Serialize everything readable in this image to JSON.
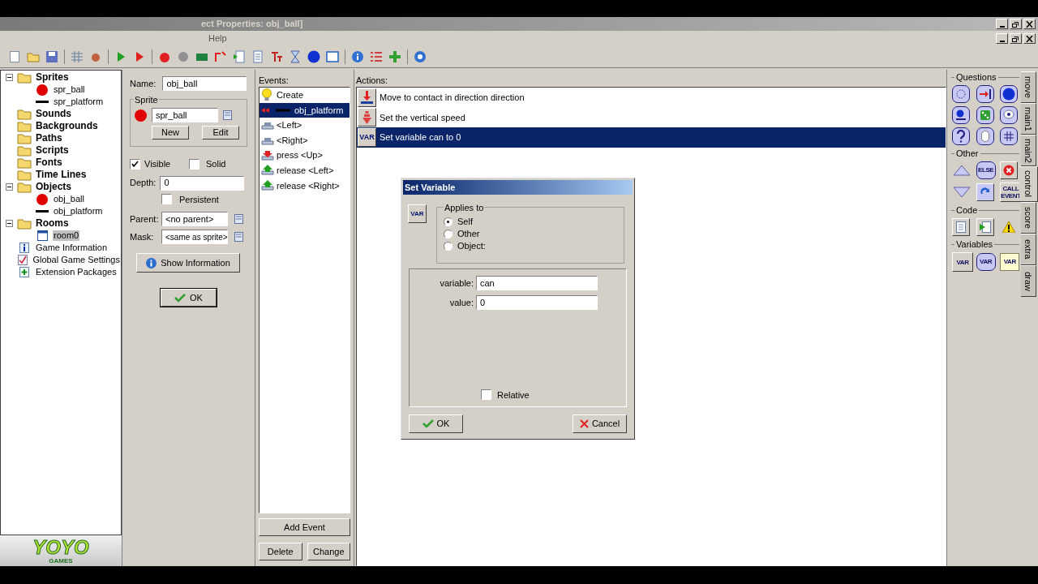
{
  "window": {
    "title": "ect Properties: obj_ball]"
  },
  "menu": [
    "Help"
  ],
  "tree": [
    {
      "label": "Sprites",
      "kind": "folder",
      "expanded": true,
      "selected": false,
      "children": [
        {
          "label": "spr_ball",
          "kind": "ball",
          "selected": false
        },
        {
          "label": "spr_platform",
          "kind": "bar",
          "selected": false
        }
      ]
    },
    {
      "label": "Sounds",
      "kind": "folder",
      "expanded": false,
      "selected": false
    },
    {
      "label": "Backgrounds",
      "kind": "folder",
      "expanded": false,
      "selected": false
    },
    {
      "label": "Paths",
      "kind": "folder",
      "expanded": false,
      "selected": false
    },
    {
      "label": "Scripts",
      "kind": "folder",
      "expanded": false,
      "selected": false
    },
    {
      "label": "Fonts",
      "kind": "folder",
      "expanded": false,
      "selected": false
    },
    {
      "label": "Time Lines",
      "kind": "folder",
      "expanded": false,
      "selected": false
    },
    {
      "label": "Objects",
      "kind": "folder",
      "expanded": true,
      "selected": false,
      "children": [
        {
          "label": "obj_ball",
          "kind": "ball",
          "selected": false
        },
        {
          "label": "obj_platform",
          "kind": "bar",
          "selected": false
        }
      ]
    },
    {
      "label": "Rooms",
      "kind": "folder",
      "expanded": true,
      "selected": false,
      "children": [
        {
          "label": "room0",
          "kind": "room",
          "selected": true
        }
      ]
    },
    {
      "label": "Game Information",
      "kind": "info",
      "selected": false
    },
    {
      "label": "Global Game Settings",
      "kind": "settings",
      "selected": false
    },
    {
      "label": "Extension Packages",
      "kind": "extension",
      "selected": false
    }
  ],
  "logo": {
    "name": "YOYO",
    "sub": "GAMES"
  },
  "properties": {
    "name_label": "Name:",
    "name": "obj_ball",
    "sprite_group": "Sprite",
    "sprite": "spr_ball",
    "new": "New",
    "edit": "Edit",
    "visible": {
      "label": "Visible",
      "checked": true
    },
    "solid": {
      "label": "Solid",
      "checked": false
    },
    "depth_label": "Depth:",
    "depth": "0",
    "persistent": {
      "label": "Persistent",
      "checked": false
    },
    "parent_label": "Parent:",
    "parent": "<no parent>",
    "mask_label": "Mask:",
    "mask": "<same as sprite>",
    "show_info": "Show Information",
    "ok": "OK"
  },
  "events": {
    "label": "Events:",
    "items": [
      {
        "label": "Create",
        "kind": "create",
        "selected": false
      },
      {
        "label": "obj_platform",
        "kind": "collision",
        "selected": true
      },
      {
        "label": "<Left>",
        "kind": "keyboard",
        "selected": false
      },
      {
        "label": "<Right>",
        "kind": "keyboard",
        "selected": false
      },
      {
        "label": "press <Up>",
        "kind": "press",
        "selected": false
      },
      {
        "label": "release <Left>",
        "kind": "release",
        "selected": false
      },
      {
        "label": "release <Right>",
        "kind": "release",
        "selected": false
      }
    ],
    "add": "Add Event",
    "delete": "Delete",
    "change": "Change"
  },
  "actions": {
    "label": "Actions:",
    "items": [
      {
        "label": "Move to contact in direction direction",
        "kind": "contact",
        "selected": false
      },
      {
        "label": "Set the vertical speed",
        "kind": "vspeed",
        "selected": false
      },
      {
        "label": "Set variable can to 0",
        "kind": "var",
        "icon_text": "VAR",
        "selected": true
      }
    ]
  },
  "dialog": {
    "title": "Set Variable",
    "icon_text": "VAR",
    "applies_label": "Applies to",
    "applies": [
      {
        "label": "Self",
        "selected": true
      },
      {
        "label": "Other",
        "selected": false
      },
      {
        "label": "Object:",
        "selected": false
      }
    ],
    "fields": [
      {
        "label": "variable:",
        "value": "can"
      },
      {
        "label": "value:",
        "value": "0"
      }
    ],
    "relative": {
      "label": "Relative",
      "checked": false
    },
    "ok": "OK",
    "cancel": "Cancel"
  },
  "palette": [
    {
      "title": "Questions",
      "items": [
        {
          "kind": "dotted"
        },
        {
          "kind": "arrow"
        },
        {
          "kind": "ball"
        },
        {
          "kind": "balls"
        },
        {
          "kind": "dice"
        },
        {
          "kind": "bubble"
        },
        {
          "kind": "question"
        },
        {
          "kind": "mouse"
        },
        {
          "kind": "grid"
        }
      ]
    },
    {
      "title": "Other",
      "items": [
        {
          "kind": "up"
        },
        {
          "kind": "octagon",
          "text": "ELSE"
        },
        {
          "kind": "exit"
        },
        {
          "kind": "down"
        },
        {
          "kind": "repeat"
        },
        {
          "kind": "square",
          "text": "CALL EVENT"
        }
      ]
    },
    {
      "title": "Code",
      "items": [
        {
          "kind": "page"
        },
        {
          "kind": "pageplay"
        },
        {
          "kind": "warning"
        }
      ]
    },
    {
      "title": "Variables",
      "items": [
        {
          "kind": "square",
          "text": "VAR"
        },
        {
          "kind": "octagon",
          "text": "VAR"
        },
        {
          "kind": "note",
          "text": "VAR"
        }
      ]
    }
  ],
  "side_tabs": [
    {
      "label": "move",
      "selected": false
    },
    {
      "label": "main1",
      "selected": false
    },
    {
      "label": "main2",
      "selected": false
    },
    {
      "label": "control",
      "selected": true
    },
    {
      "label": "score",
      "selected": false
    },
    {
      "label": "extra",
      "selected": false
    },
    {
      "label": "draw",
      "selected": false
    }
  ]
}
